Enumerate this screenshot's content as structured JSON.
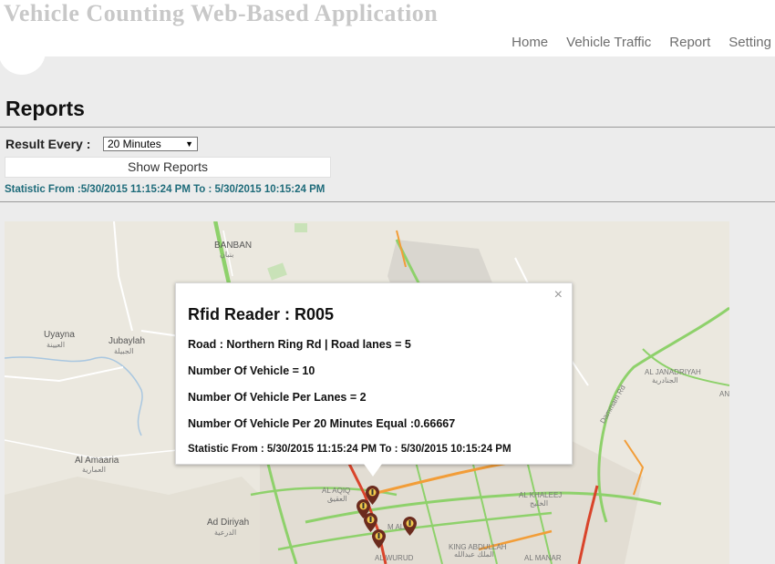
{
  "header": {
    "app_title": "Vehicle Counting Web-Based Application",
    "nav": [
      "Home",
      "Vehicle Traffic",
      "Report",
      "Setting"
    ]
  },
  "page": {
    "title": "Reports",
    "result_every_label": "Result Every :",
    "result_every_value": "20 Minutes",
    "show_button": "Show Reports",
    "statistic": "Statistic From :5/30/2015 11:15:24 PM To : 5/30/2015 10:15:24 PM"
  },
  "popup": {
    "close": "×",
    "title": "Rfid Reader : R005",
    "road": "Road : Northern Ring Rd | Road lanes = 5",
    "vehicles": "Number Of Vehicle = 10",
    "per_lanes": "Number Of Vehicle Per Lanes = 2",
    "per_interval": "Number Of Vehicle Per 20 Minutes Equal :0.66667",
    "statistic": "Statistic From : 5/30/2015 11:15:24 PM To : 5/30/2015 10:15:24 PM"
  },
  "map": {
    "labels": {
      "banban": "BANBAN",
      "banban_ar": "بنبان",
      "uyayna": "Uyayna",
      "uyayna_ar": "العيينة",
      "jubaylah": "Jubaylah",
      "jubaylah_ar": "الجبيلة",
      "amaaria": "Al Amaaria",
      "amaaria_ar": "العمارية",
      "diriyah": "Ad Diriyah",
      "diriyah_ar": "الدرعية",
      "janadriyah": "AL JANADRIYAH",
      "janadriyah_ar": "الجنادرية",
      "dammam_rd": "Dammam Rd",
      "an": "AN",
      "aqiq": "AL AQIQ",
      "aqiq_ar": "العقيق",
      "khaleej": "AL KHALEEJ",
      "khaleej_ar": "الخليج",
      "king_abdullah": "KING ABDULLAH",
      "king_abdullah_ar": "الملك عبدالله",
      "manar": "AL MANAR",
      "wurud": "AL WURUD",
      "malaz": "M  ALAT"
    },
    "colors": {
      "highway_green": "#8ed16b",
      "highway_orange": "#f29d38",
      "highway_red": "#d9442b",
      "map_bg": "#ebe8df"
    }
  }
}
